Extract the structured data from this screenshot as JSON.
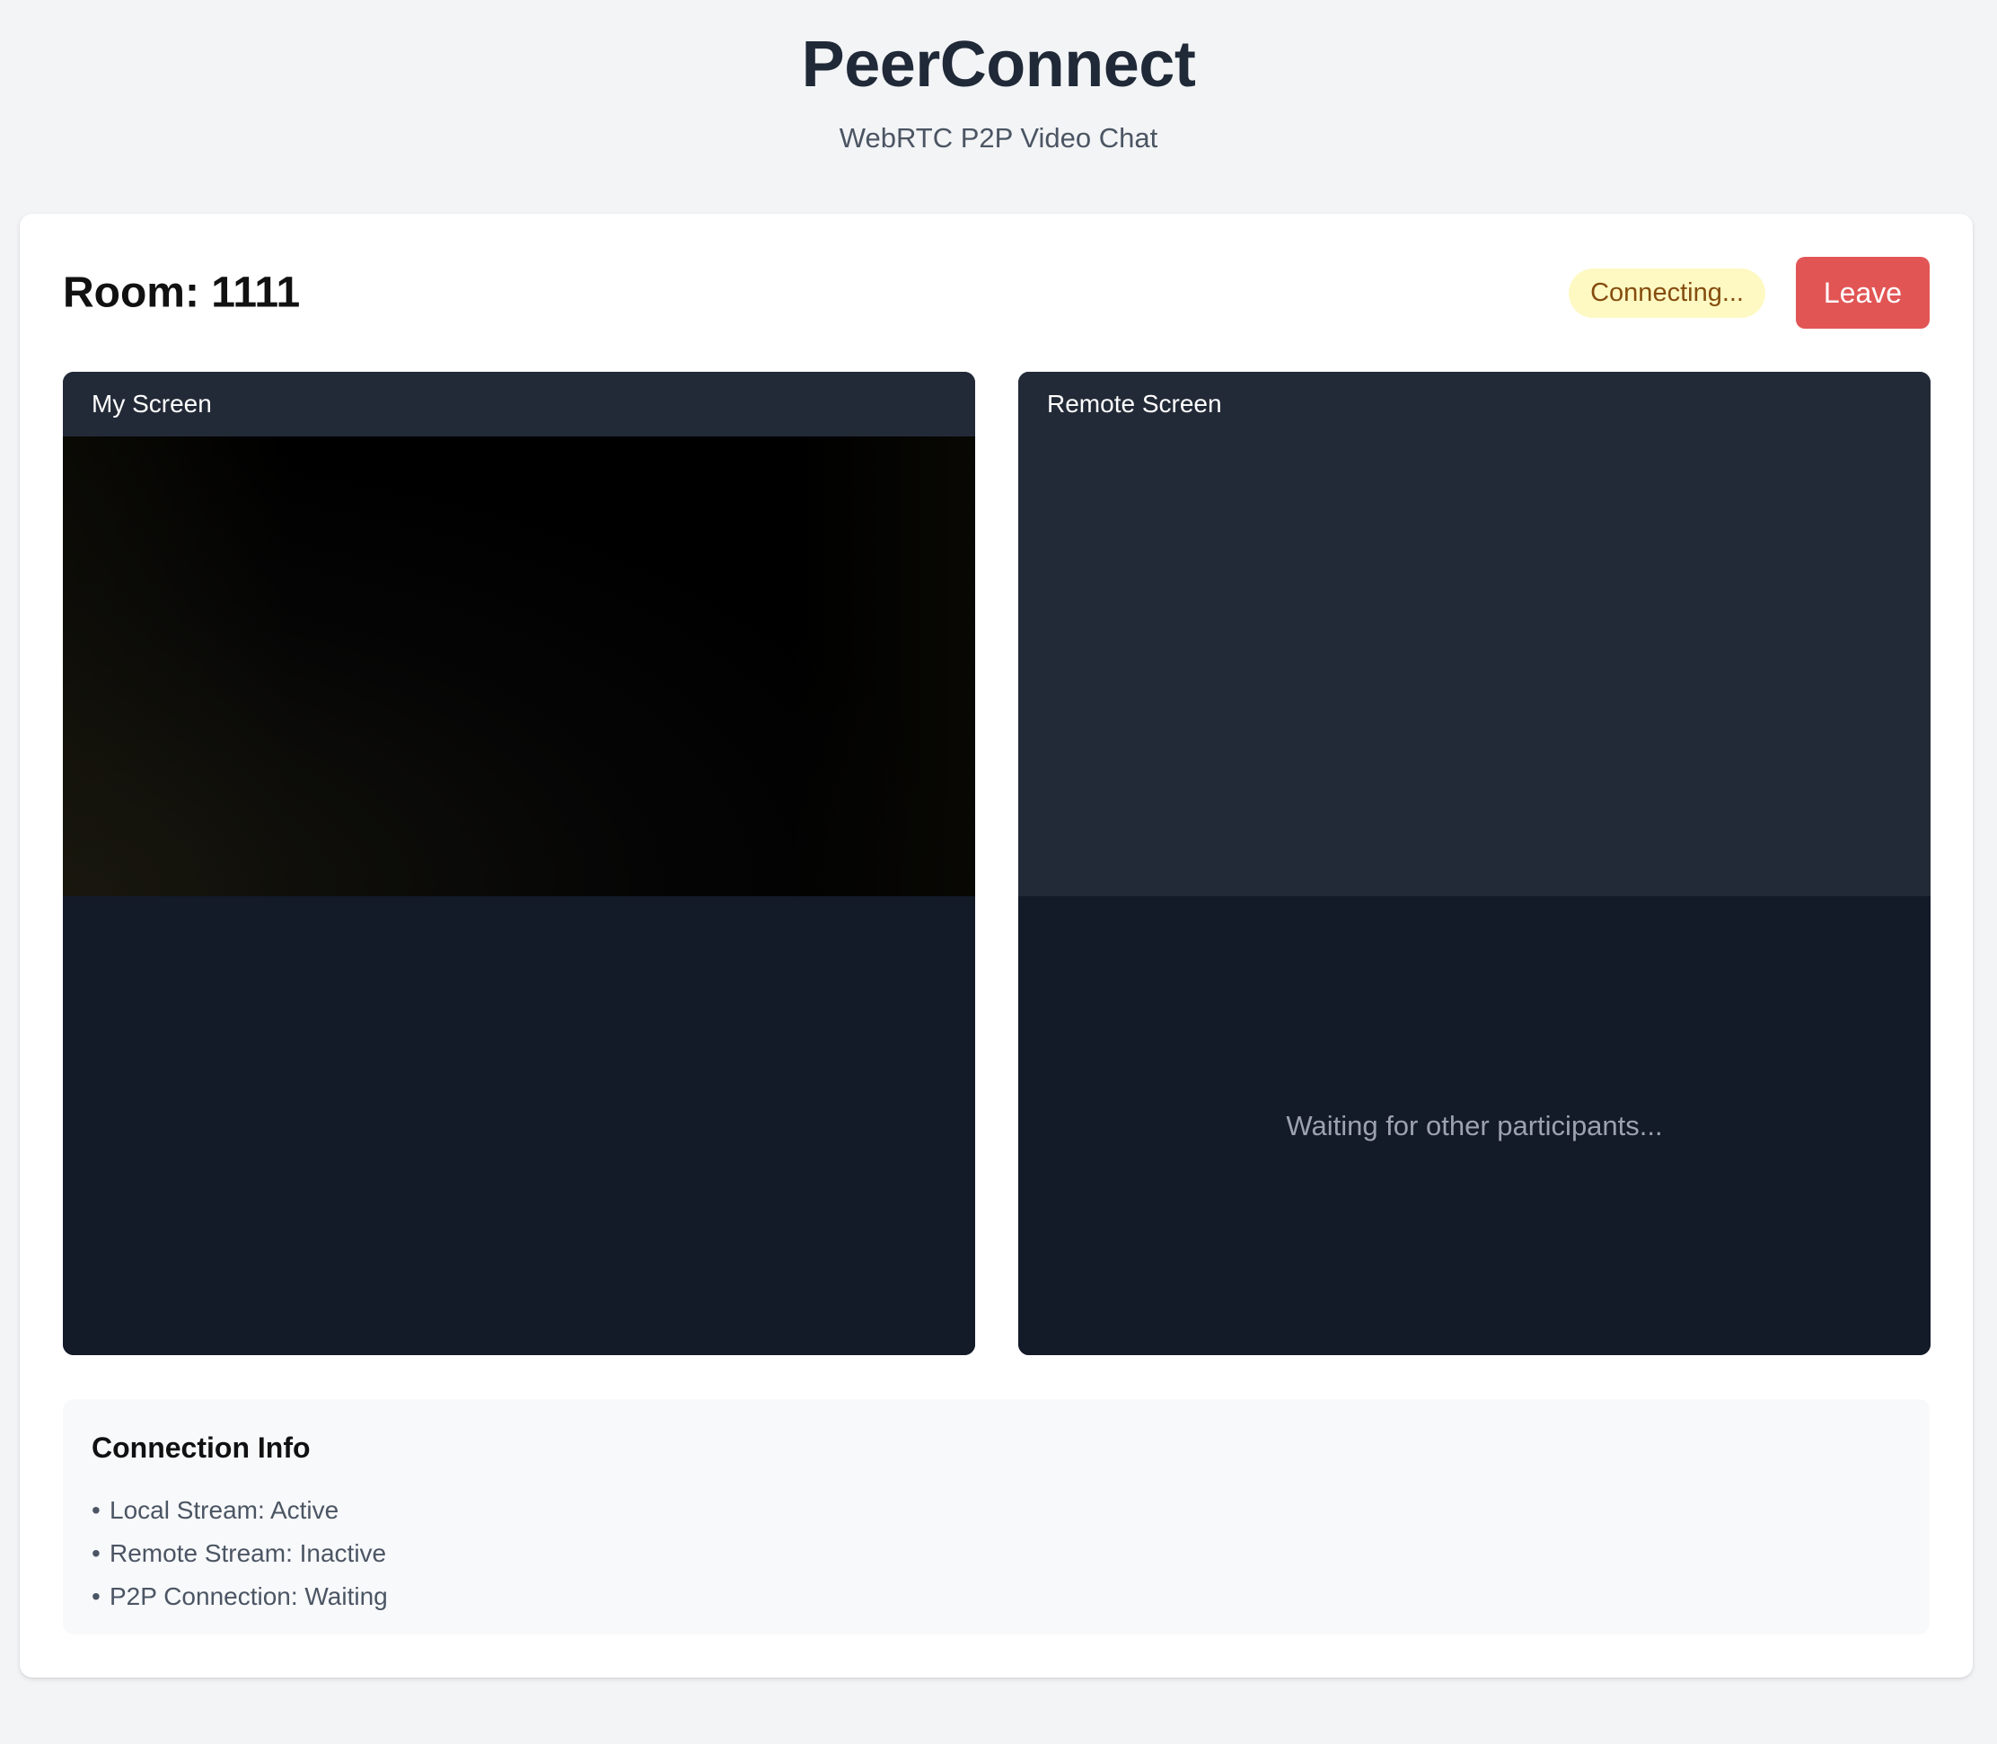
{
  "header": {
    "title": "PeerConnect",
    "subtitle": "WebRTC P2P Video Chat"
  },
  "room": {
    "title": "Room: 1111",
    "status": "Connecting...",
    "leave_label": "Leave"
  },
  "panels": {
    "local": {
      "label": "My Screen"
    },
    "remote": {
      "label": "Remote Screen",
      "waiting_text": "Waiting for other participants..."
    }
  },
  "connection_info": {
    "title": "Connection Info",
    "bullet": "•",
    "items": [
      "Local Stream: Active",
      "Remote Stream: Inactive",
      "P2P Connection: Waiting"
    ]
  },
  "colors": {
    "page_bg": "#f3f4f6",
    "leave_button": "#e25555",
    "status_badge_bg": "#fef9c3",
    "status_badge_text": "#854d0e",
    "panel_header": "#232a37",
    "panel_body": "#131a28"
  }
}
